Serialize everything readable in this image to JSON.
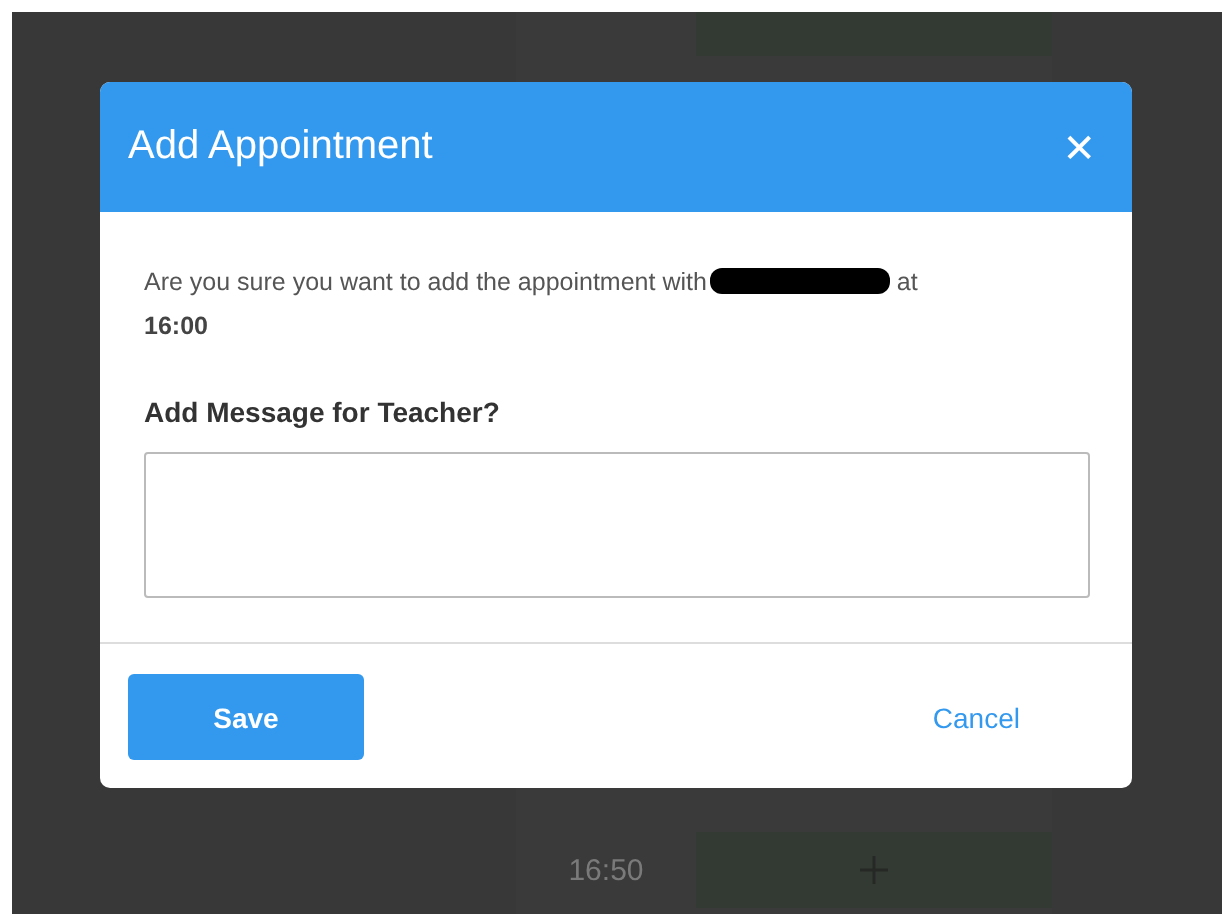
{
  "schedule": {
    "slots": [
      {
        "time": "16:50"
      }
    ]
  },
  "dialog": {
    "title": "Add Appointment",
    "close": "✕",
    "message": {
      "before": "Are you sure you want to add the appointment with",
      "after": "at",
      "time": "16:00"
    },
    "field": {
      "label": "Add Message for Teacher?"
    },
    "buttons": [
      {
        "label": "Save",
        "kind": "primary"
      },
      {
        "label": "Cancel",
        "kind": "link"
      }
    ]
  }
}
